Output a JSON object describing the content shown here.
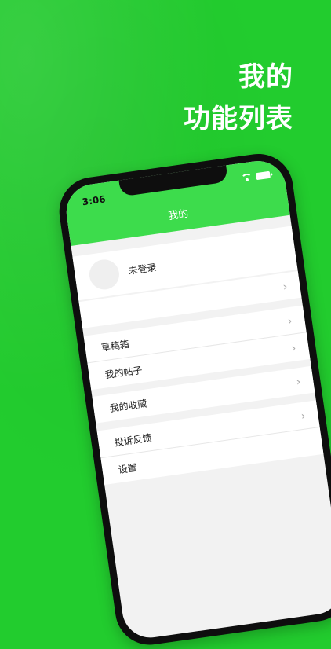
{
  "headline": {
    "line1": "我的",
    "line2": "功能列表"
  },
  "status": {
    "time": "3:06"
  },
  "nav": {
    "title": "我的"
  },
  "profile": {
    "login_text": "未登录"
  },
  "menu": {
    "chevron": "›",
    "items": [
      {
        "label": "草稿箱"
      },
      {
        "label": "我的帖子"
      },
      {
        "label": "我的收藏"
      },
      {
        "label": "投诉反馈"
      },
      {
        "label": "设置"
      }
    ]
  },
  "colors": {
    "background": "#22cc2e",
    "header": "#3ddc4c"
  }
}
